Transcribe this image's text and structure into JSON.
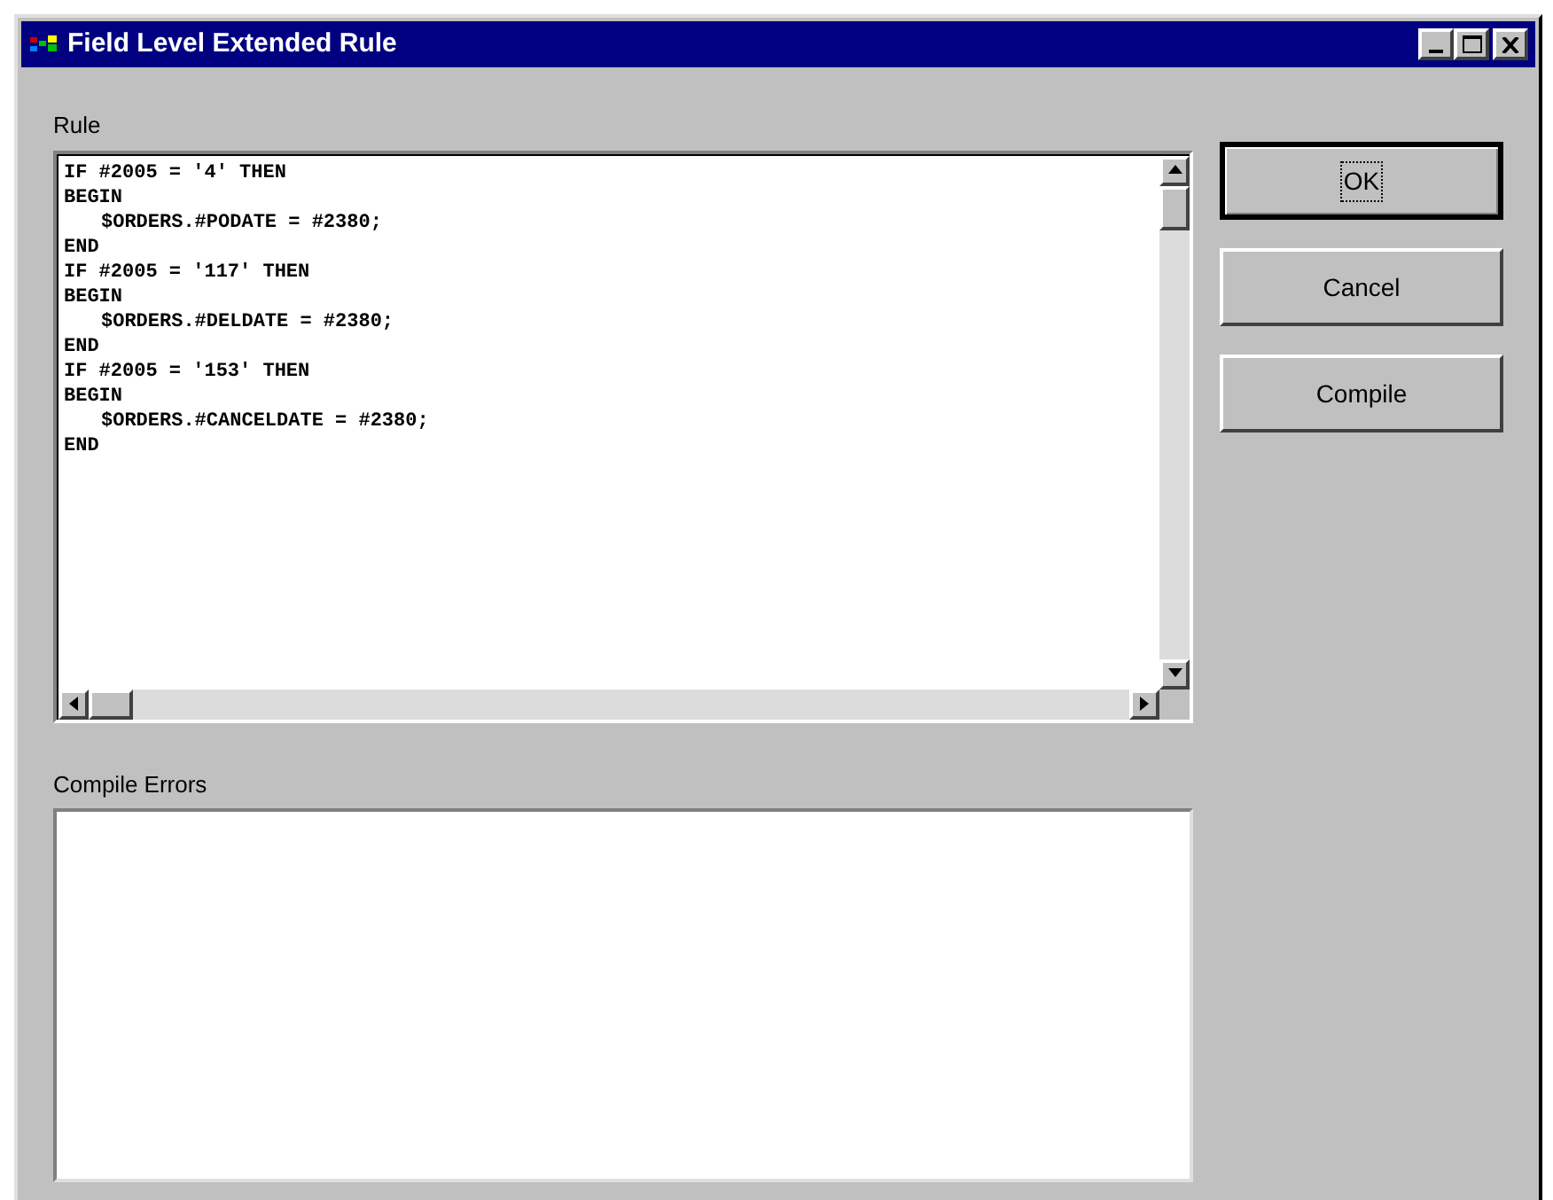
{
  "window": {
    "title": "Field Level Extended Rule"
  },
  "rule": {
    "label": "Rule",
    "lines": [
      {
        "text": "IF #2005 = '4' THEN",
        "indent": false
      },
      {
        "text": "BEGIN",
        "indent": false
      },
      {
        "text": "$ORDERS.#PODATE = #2380;",
        "indent": true
      },
      {
        "text": "END",
        "indent": false
      },
      {
        "text": "IF #2005 = '117' THEN",
        "indent": false
      },
      {
        "text": "BEGIN",
        "indent": false
      },
      {
        "text": "$ORDERS.#DELDATE = #2380;",
        "indent": true
      },
      {
        "text": "END",
        "indent": false
      },
      {
        "text": "IF #2005 = '153' THEN",
        "indent": false
      },
      {
        "text": "BEGIN",
        "indent": false
      },
      {
        "text": "$ORDERS.#CANCELDATE = #2380;",
        "indent": true
      },
      {
        "text": "END",
        "indent": false
      }
    ]
  },
  "compile_errors": {
    "label": "Compile Errors"
  },
  "buttons": [
    {
      "label": "OK",
      "default": true
    },
    {
      "label": "Cancel",
      "default": false
    },
    {
      "label": "Compile",
      "default": false
    }
  ]
}
